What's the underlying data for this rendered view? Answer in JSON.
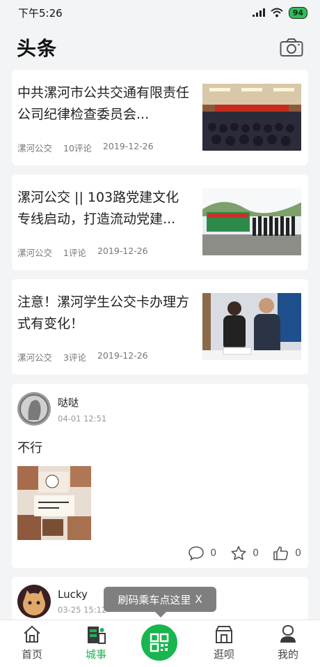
{
  "status": {
    "time": "下午5:26",
    "battery": "94"
  },
  "header": {
    "title": "头条",
    "camera_icon": "camera-icon"
  },
  "news": [
    {
      "title": "中共漯河市公共交通有限责任公司纪律检查委员会...",
      "source": "漯河公交",
      "comments": "10评论",
      "date": "2019-12-26"
    },
    {
      "title": "漯河公交 || 103路党建文化专线启动，打造流动党建...",
      "source": "漯河公交",
      "comments": "1评论",
      "date": "2019-12-26"
    },
    {
      "title": "注意！漯河学生公交卡办理方式有变化！",
      "source": "漯河公交",
      "comments": "3评论",
      "date": "2019-12-26"
    }
  ],
  "post": {
    "user": "哒哒",
    "time": "04-01 12:51",
    "text": "不行",
    "comments": "0",
    "favorites": "0",
    "likes": "0"
  },
  "post2": {
    "user": "Lucky",
    "time": "03-25 15:12"
  },
  "tooltip": {
    "text": "刷码乘车点这里",
    "close": "X"
  },
  "tabs": [
    {
      "label": "首页",
      "icon": "home-icon"
    },
    {
      "label": "城事",
      "icon": "city-icon",
      "active": true
    },
    {
      "label": "",
      "icon": "qr-scan-icon"
    },
    {
      "label": "逛呗",
      "icon": "shop-icon"
    },
    {
      "label": "我的",
      "icon": "profile-icon"
    }
  ],
  "colors": {
    "accent": "#1fb156",
    "tooltip_bg": "#7f7f7f",
    "page_bg": "#f3f4f6"
  }
}
